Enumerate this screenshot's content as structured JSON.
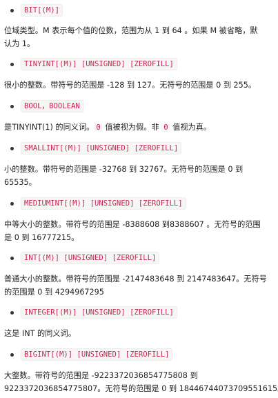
{
  "items": [
    {
      "code": "BIT[(M)]",
      "desc_lines": [
        "位域类型。M 表示每个值的位数，范围为从 1 到 64 。如果 M 被省略，默",
        "认为 1。"
      ]
    },
    {
      "code": "TINYINT[(M)] [UNSIGNED] [ZEROFILL]",
      "desc_lines": [
        "很小的整数。带符号的范围是 -128 到 127。无符号的范围是 0 到 255。"
      ]
    },
    {
      "code": "BOOL，BOOLEAN",
      "desc_parts": {
        "text_a": "是TINYINT(1) 的同义词。",
        "code_a": "0",
        "text_b": " 值被视为假。非 ",
        "code_b": "0",
        "text_c": " 值视为真。"
      }
    },
    {
      "code": "SMALLINT[(M)] [UNSIGNED] [ZEROFILL]",
      "desc_lines": [
        "小的整数。带符号的范围是 -32768 到 32767。无符号的范围是 0 到",
        "65535。"
      ]
    },
    {
      "code": "MEDIUMINT[(M)] [UNSIGNED] [ZEROFILL]",
      "desc_lines": [
        "中等大小的整数。带符号的范围是 -8388608 到8388607 。无符号的范围",
        "是 0 到 16777215。"
      ]
    },
    {
      "code": "INT[(M)] [UNSIGNED] [ZEROFILL]",
      "desc_lines": [
        "普通大小的整数。带符号的范围是 -2147483648 到 2147483647。无符号",
        "的范围是 0 到 4294967295"
      ]
    },
    {
      "code": "INTEGER[(M)] [UNSIGNED] [ZEROFILL]",
      "desc_lines": [
        "这是 INT 的同义词。"
      ]
    },
    {
      "code": "BIGINT[(M)] [UNSIGNED] [ZEROFILL]",
      "desc_lines": [
        "大整数。带符号的范围是 -9223372036854775808 到",
        "9223372036854775807。无符号的范围是 0 到 18446744073709551615。"
      ]
    }
  ]
}
